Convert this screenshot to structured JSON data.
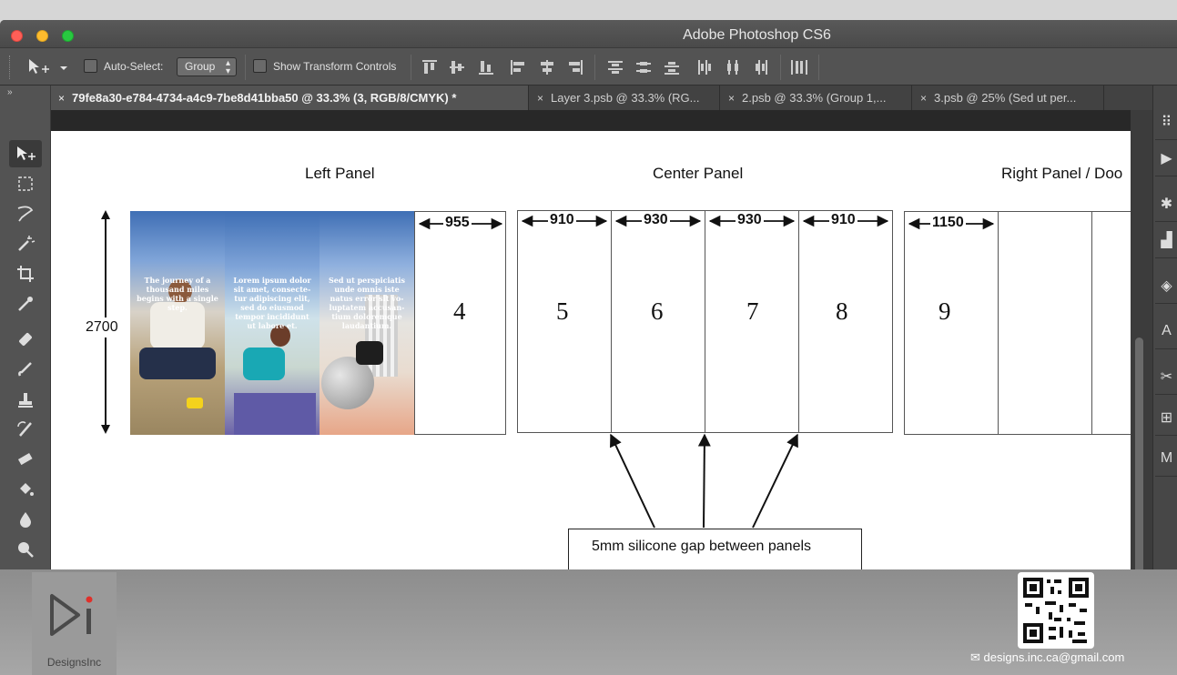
{
  "app": {
    "title": "Adobe Photoshop CS6"
  },
  "options": {
    "auto_select_label": "Auto-Select:",
    "auto_select_value": "Group",
    "transform_label": "Show Transform Controls"
  },
  "tabs": [
    {
      "label": "79fe8a30-e784-4734-a4c9-7be8d41bba50 @ 33.3% (3, RGB/8/CMYK) *",
      "active": true
    },
    {
      "label": "Layer 3.psb @ 33.3% (RG..."
    },
    {
      "label": "2.psb @ 33.3% (Group 1,..."
    },
    {
      "label": "3.psb @ 25% (Sed ut per..."
    }
  ],
  "document": {
    "left_panel_label": "Left Panel",
    "center_panel_label": "Center Panel",
    "right_panel_label": "Right Panel / Doo",
    "height_dim": "2700",
    "panel_numbers": [
      "4",
      "5",
      "6",
      "7",
      "8",
      "9"
    ],
    "widths": [
      "955",
      "910",
      "930",
      "930",
      "910",
      "1150"
    ],
    "callout": "5mm silicone gap between panels",
    "photo_texts": [
      "The journey of a thousand miles begins with a single step.",
      "Lorem ipsum dolor sit amet, consecte-tur adipiscing elit, sed do eiusmod tempor incididunt ut labore et.",
      "Sed ut perspiciatis unde omnis iste natus error sit vo-luptatem accusan-tium doloremque laudantium."
    ]
  },
  "footer": {
    "logo_text": "DesignsInc",
    "email": "designs.inc.ca@gmail.com"
  },
  "colors": {
    "accent_red": "#e0302a",
    "chrome": "#535353"
  }
}
